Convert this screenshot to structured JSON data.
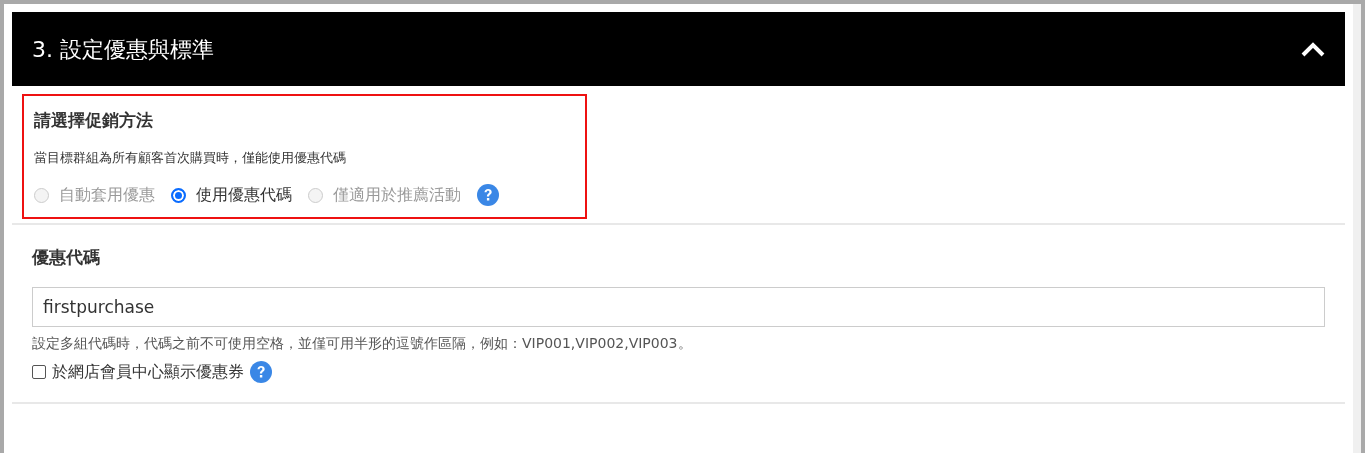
{
  "panel": {
    "title": "3. 設定優惠與標準",
    "expanded": true
  },
  "promotion_method": {
    "heading": "請選擇促銷方法",
    "note": "當目標群組為所有顧客首次購買時，僅能使用優惠代碼",
    "highlighted": true,
    "options": [
      {
        "label": "自動套用優惠",
        "selected": false,
        "disabled": true
      },
      {
        "label": "使用優惠代碼",
        "selected": true,
        "disabled": false
      },
      {
        "label": "僅適用於推薦活動",
        "selected": false,
        "disabled": true
      }
    ]
  },
  "coupon_code": {
    "heading": "優惠代碼",
    "value": "firstpurchase",
    "hint": "設定多組代碼時，代碼之前不可使用空格，並僅可用半形的逗號作區隔，例如：VIP001,VIP002,VIP003。",
    "show_in_member_center": {
      "label": "於網店會員中心顯示優惠券",
      "checked": false
    }
  }
}
